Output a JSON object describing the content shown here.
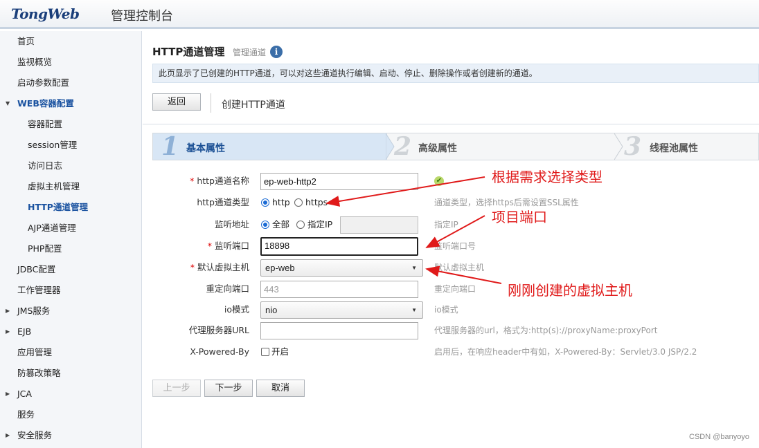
{
  "header": {
    "logo": "TongWeb",
    "subtitle": "管理控制台"
  },
  "sidebar": {
    "items": [
      {
        "label": "首页"
      },
      {
        "label": "监视概览"
      },
      {
        "label": "启动参数配置"
      },
      {
        "label": "WEB容器配置"
      },
      {
        "label": "容器配置"
      },
      {
        "label": "session管理"
      },
      {
        "label": "访问日志"
      },
      {
        "label": "虚拟主机管理"
      },
      {
        "label": "HTTP通道管理"
      },
      {
        "label": "AJP通道管理"
      },
      {
        "label": "PHP配置"
      },
      {
        "label": "JDBC配置"
      },
      {
        "label": "工作管理器"
      },
      {
        "label": "JMS服务"
      },
      {
        "label": "EJB"
      },
      {
        "label": "应用管理"
      },
      {
        "label": "防篡改策略"
      },
      {
        "label": "JCA"
      },
      {
        "label": "服务"
      },
      {
        "label": "安全服务"
      }
    ]
  },
  "main": {
    "title": "HTTP通道管理",
    "subtitle": "管理通道",
    "info_icon": "i",
    "description": "此页显示了已创建的HTTP通道，可以对这些通道执行编辑、启动、停止、删除操作或者创建新的通道。",
    "back_button": "返回",
    "section_title": "创建HTTP通道"
  },
  "steps": [
    {
      "num": "1",
      "label": "基本属性"
    },
    {
      "num": "2",
      "label": "高级属性"
    },
    {
      "num": "3",
      "label": "线程池属性"
    }
  ],
  "form": {
    "name": {
      "label": "http通道名称",
      "value": "ep-web-http2"
    },
    "type": {
      "label": "http通道类型",
      "opt1": "http",
      "opt2": "https",
      "hint": "通道类型，选择https后需设置SSL属性"
    },
    "listen": {
      "label": "监听地址",
      "opt1": "全部",
      "opt2": "指定IP",
      "ip_value": "",
      "hint": "指定IP"
    },
    "port": {
      "label": "监听端口",
      "value": "18898",
      "hint": "监听端口号"
    },
    "vhost": {
      "label": "默认虚拟主机",
      "value": "ep-web",
      "hint": "默认虚拟主机"
    },
    "redirect": {
      "label": "重定向端口",
      "value": "443",
      "hint": "重定向端口"
    },
    "io": {
      "label": "io模式",
      "value": "nio",
      "hint": "io模式"
    },
    "proxy": {
      "label": "代理服务器URL",
      "value": "",
      "hint": "代理服务器的url，格式为:http(s)://proxyName:proxyPort"
    },
    "xpowered": {
      "label": "X-Powered-By",
      "opt": "开启",
      "hint": "启用后，在响应header中有如，X-Powered-By：Servlet/3.0 JSP/2.2"
    }
  },
  "buttons": {
    "prev": "上一步",
    "next": "下一步",
    "cancel": "取消"
  },
  "annotations": {
    "a1": "根据需求选择类型",
    "a2": "项目端口",
    "a3": "刚刚创建的虚拟主机"
  },
  "watermark": "CSDN @banyoyo",
  "colors": {
    "accent": "#1a52a0",
    "annotation": "#e01a1a"
  }
}
